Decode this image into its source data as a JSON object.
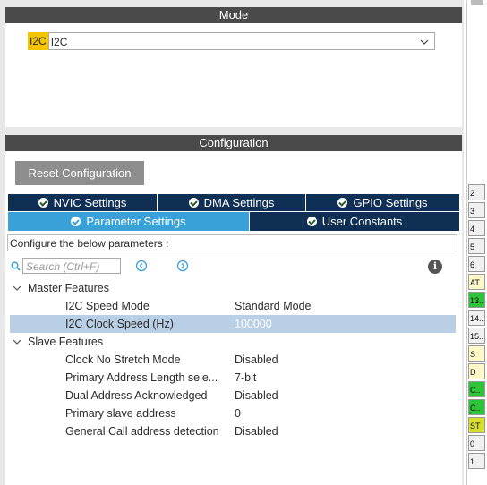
{
  "mode": {
    "header": "Mode",
    "label": "I2C",
    "selected": "I2C"
  },
  "config": {
    "header": "Configuration",
    "reset_label": "Reset Configuration",
    "tabs_row1": [
      "NVIC Settings",
      "DMA Settings",
      "GPIO Settings"
    ],
    "tabs_row2": [
      "Parameter Settings",
      "User Constants"
    ],
    "active_tab": "Parameter Settings",
    "description": "Configure the below parameters :",
    "search_placeholder": "Search (Ctrl+F)"
  },
  "tree": {
    "master": {
      "label": "Master Features",
      "params": [
        {
          "name": "I2C Speed Mode",
          "value": "Standard Mode"
        },
        {
          "name": "I2C Clock Speed (Hz)",
          "value": "100000"
        }
      ]
    },
    "slave": {
      "label": "Slave Features",
      "params": [
        {
          "name": "Clock No Stretch Mode",
          "value": "Disabled"
        },
        {
          "name": "Primary Address Length sele...",
          "value": "7-bit"
        },
        {
          "name": "Dual Address Acknowledged",
          "value": "Disabled"
        },
        {
          "name": "Primary slave address",
          "value": "0"
        },
        {
          "name": "General Call address detection",
          "value": "Disabled"
        }
      ]
    }
  },
  "pins": [
    {
      "label": "2",
      "color": "#f0f0f0"
    },
    {
      "label": "3",
      "color": "#f0f0f0"
    },
    {
      "label": "4",
      "color": "#f0f0f0"
    },
    {
      "label": "5",
      "color": "#f0f0f0"
    },
    {
      "label": "6",
      "color": "#f0f0f0"
    },
    {
      "label": "AT",
      "color": "#fff8c8"
    },
    {
      "label": "13..",
      "color": "#2ec43a"
    },
    {
      "label": "14..",
      "color": "#f0f0f0"
    },
    {
      "label": "15..",
      "color": "#f0f0f0"
    },
    {
      "label": "S",
      "color": "#fff8c8"
    },
    {
      "label": "D",
      "color": "#fff8c8"
    },
    {
      "label": "C..",
      "color": "#2ec43a"
    },
    {
      "label": "C..",
      "color": "#2ec43a"
    },
    {
      "label": "ST",
      "color": "#d6e02a"
    },
    {
      "label": "0",
      "color": "#f0f0f0"
    },
    {
      "label": "1",
      "color": "#f0f0f0"
    }
  ]
}
